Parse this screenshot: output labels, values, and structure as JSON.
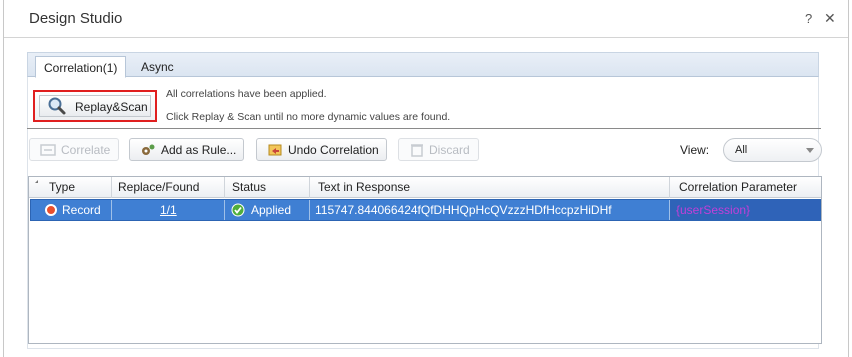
{
  "window": {
    "title": "Design Studio",
    "help_label": "?",
    "close_label": "✕"
  },
  "tabs": [
    {
      "label": "Correlation(1)",
      "active": true
    },
    {
      "label": "Async",
      "active": false
    }
  ],
  "replay_button": {
    "label": "Replay&Scan",
    "icon": "magnifier-icon"
  },
  "info": {
    "line1": "All correlations have been applied.",
    "line2": "Click Replay & Scan until no more dynamic values are found."
  },
  "toolbar": {
    "correlate_label": "Correlate",
    "add_rule_label": "Add as Rule...",
    "undo_label": "Undo Correlation",
    "discard_label": "Discard",
    "view_label": "View:",
    "view_value": "All"
  },
  "grid": {
    "columns": [
      "Type",
      "Replace/Found",
      "Status",
      "Text in Response",
      "Correlation Parameter"
    ],
    "rows": [
      {
        "type": "Record",
        "replace_found": "1/1",
        "status": "Applied",
        "text": "115747.844066424fQfDHHQpHcQVzzzHDfHccpzHiDHf",
        "param": "{userSession}"
      }
    ]
  },
  "colors": {
    "highlight_border": "#e01f1f",
    "row_selected": "#3f7fd3",
    "param_text": "#c23fd8"
  }
}
